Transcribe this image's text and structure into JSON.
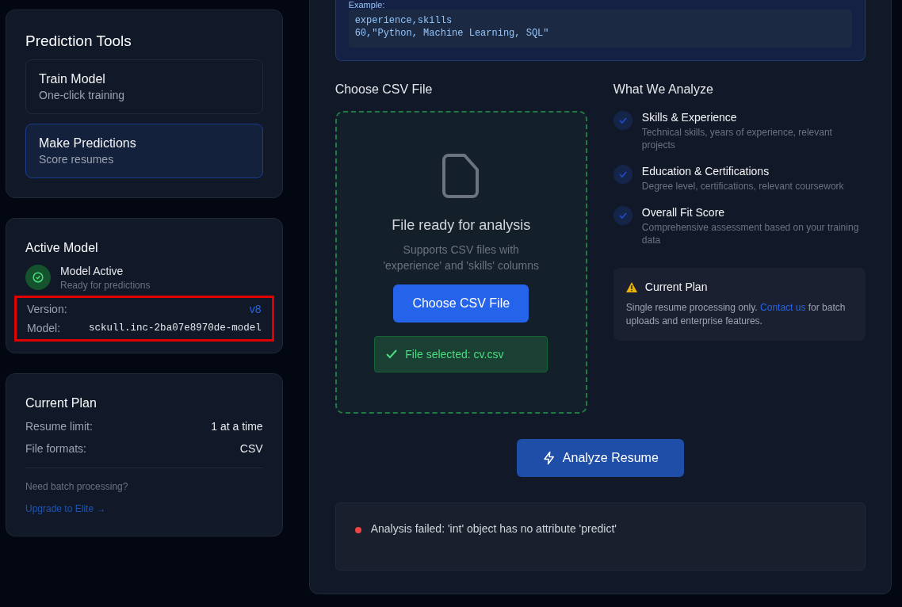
{
  "sidebar": {
    "prediction_tools": {
      "title": "Prediction Tools",
      "items": [
        {
          "title": "Train Model",
          "subtitle": "One-click training",
          "selected": false
        },
        {
          "title": "Make Predictions",
          "subtitle": "Score resumes",
          "selected": true
        }
      ]
    },
    "active_model": {
      "title": "Active Model",
      "status": "Model Active",
      "status_detail": "Ready for predictions",
      "active": true,
      "details": {
        "highlighted": true,
        "rows": [
          {
            "label": "Version:",
            "value": "v8",
            "kind": "link"
          },
          {
            "label": "Model:",
            "value": "sckull.inc-2ba07e8970de-model",
            "kind": "mono"
          }
        ]
      }
    },
    "current_plan": {
      "title": "Current Plan",
      "rows": [
        {
          "label": "Resume limit:",
          "value": "1 at a time"
        },
        {
          "label": "File formats:",
          "value": "CSV"
        }
      ],
      "note": "Need batch processing?",
      "link": "Upgrade to Elite →"
    }
  },
  "main": {
    "example": {
      "label": "Example:",
      "lines": [
        "experience,skills",
        "60,\"Python, Machine Learning, SQL\""
      ]
    },
    "upload": {
      "title": "Choose CSV File",
      "status": "File ready for analysis",
      "hint": "Supports CSV files with 'experience' and 'skills' columns",
      "button": "Choose CSV File",
      "file_selected": true,
      "selected_text": "File selected: cv.csv"
    },
    "analyze": {
      "title": "What We Analyze",
      "items": [
        {
          "title": "Skills & Experience",
          "description": "Technical skills, years of experience, relevant projects"
        },
        {
          "title": "Education & Certifications",
          "description": "Degree level, certifications, relevant coursework"
        },
        {
          "title": "Overall Fit Score",
          "description": "Comprehensive assessment based on your training data"
        }
      ],
      "plan_notice": {
        "title": "Current Plan",
        "text_before": "Single resume processing only.",
        "link": "Contact us",
        "text_after": "for batch uploads and enterprise features."
      }
    },
    "analyze_button": "Analyze Resume",
    "result": {
      "kind": "error",
      "message": "Analysis failed: 'int' object has no attribute 'predict'"
    }
  }
}
